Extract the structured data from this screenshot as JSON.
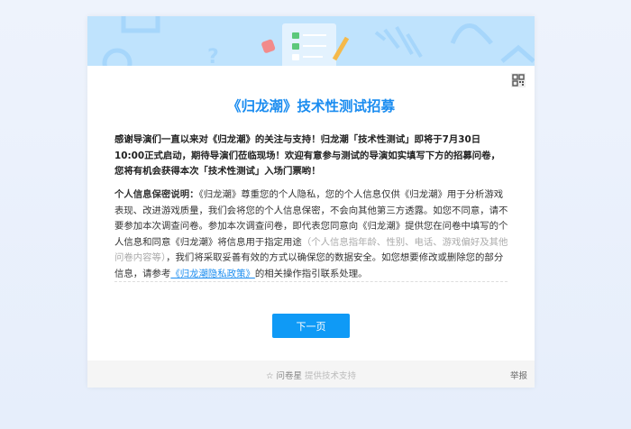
{
  "title": "《归龙潮》技术性测试招募",
  "intro": "感谢导演们一直以来对《归龙潮》的关注与支持！归龙潮「技术性测试」即将于7月30日10:00正式启动，期待导演们莅临现场！欢迎有意参与测试的导演如实填写下方的招募问卷，您将有机会获得本次「技术性测试」入场门票哟！",
  "privacy": {
    "label": "个人信息保密说明：",
    "text1": "《归龙潮》尊重您的个人隐私，您的个人信息仅供《归龙潮》用于分析游戏表现、改进游戏质量，我们会将您的个人信息保密，不会向其他第三方透露。如您不同意，请不要参加本次调查问卷。参加本次调查问卷，即代表您同意向《归龙潮》提供您在问卷中填写的个人信息和同意《归龙潮》将信息用于指定用途",
    "muted": "（个人信息指年龄、性别、电话、游戏偏好及其他问卷内容等）",
    "text2": "，我们将采取妥善有效的方式以确保您的数据安全。如您想要修改或删除您的部分信息，请参考",
    "link": "《归龙潮隐私政策》",
    "text3": "的相关操作指引联系处理。"
  },
  "next_button": "下一页",
  "footer": {
    "brand": "问卷星",
    "support": "提供技术支持",
    "report": "举报"
  },
  "icons": {
    "qr": "qr-code-icon",
    "star": "star-icon"
  },
  "colors": {
    "accent": "#1a8cf0",
    "button": "#0f9af6",
    "banner": "#bfe3fd"
  }
}
